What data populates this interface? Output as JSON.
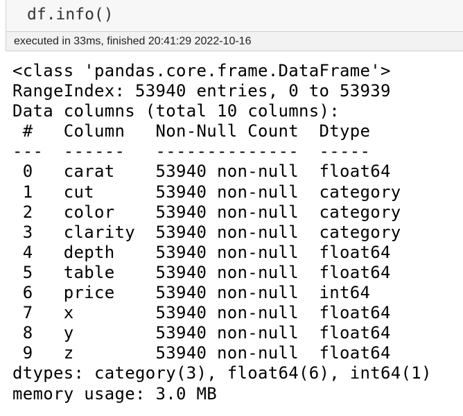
{
  "input_cell": {
    "code": "df.info()"
  },
  "execution": {
    "status_text": "executed in 33ms, finished 20:41:29 2022-10-16"
  },
  "output": {
    "lines": [
      "<class 'pandas.core.frame.DataFrame'>",
      "RangeIndex: 53940 entries, 0 to 53939",
      "Data columns (total 10 columns):",
      " #   Column   Non-Null Count  Dtype   ",
      "---  ------   --------------  -----   ",
      " 0   carat    53940 non-null  float64 ",
      " 1   cut      53940 non-null  category",
      " 2   color    53940 non-null  category",
      " 3   clarity  53940 non-null  category",
      " 4   depth    53940 non-null  float64 ",
      " 5   table    53940 non-null  float64 ",
      " 6   price    53940 non-null  int64   ",
      " 7   x        53940 non-null  float64 ",
      " 8   y        53940 non-null  float64 ",
      " 9   z        53940 non-null  float64 ",
      "dtypes: category(3), float64(6), int64(1)",
      "memory usage: 3.0 MB"
    ]
  }
}
